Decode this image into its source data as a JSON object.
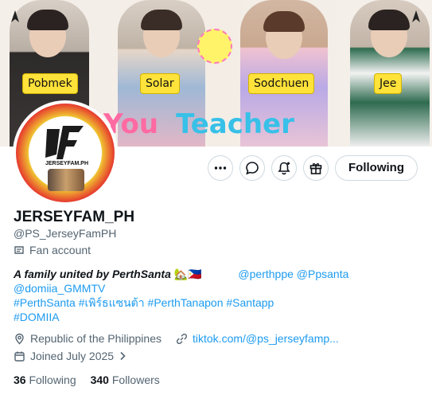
{
  "banner": {
    "names": [
      "Pobmek",
      "Solar",
      "Sodchuen",
      "Jee"
    ],
    "title_words": [
      "You",
      "Teacher"
    ],
    "title_colors": [
      "#ff6aa2",
      "#37c0e8",
      "#ffb530",
      "#7fd65a",
      "#ff6aa2",
      "#b07cff",
      "#ff8a3d",
      "#37c0e8",
      "#ff6aa2",
      "#f5f0ea"
    ]
  },
  "avatar": {
    "caption": "JERSEYFAM.PH"
  },
  "actions": {
    "more_icon": "more-icon",
    "message_icon": "message-icon",
    "notify_icon": "notify-icon",
    "subscribe_icon": "gift-icon",
    "follow_label": "Following"
  },
  "profile": {
    "display_name": "JERSEYFAM_PH",
    "handle": "@PS_JerseyFamPH",
    "badge": "Fan account",
    "bio_lead": "A family united by PerthSanta",
    "bio_emoji": "🏡🇵🇭",
    "mention1": "@perthppe",
    "mention2": "@Ppsanta",
    "mention3": "@domiia_GMMTV",
    "hashtags": "#PerthSanta #เพิร์ธแซนต้า #PerthTanapon #Santapp",
    "hashtag_last": "#DOMIIA",
    "location": "Republic of the Philippines",
    "website": "tiktok.com/@ps_jerseyfamp...",
    "joined": "Joined July 2025"
  },
  "counts": {
    "following_num": "36",
    "following_label": "Following",
    "followers_num": "340",
    "followers_label": "Followers"
  },
  "colors": {
    "accent": "#1d9bf0",
    "secondary_text": "#536471",
    "border": "#cfd9de"
  }
}
